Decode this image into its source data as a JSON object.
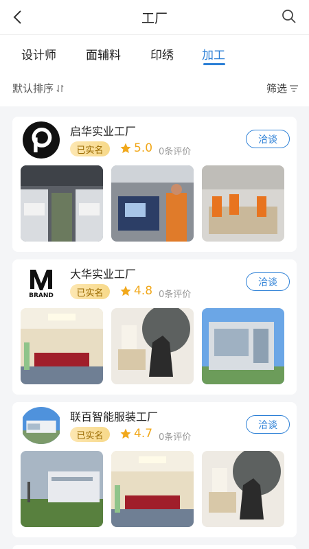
{
  "header": {
    "title": "工厂",
    "back_icon": "chevron-left-icon",
    "search_icon": "search-icon"
  },
  "tabs": [
    {
      "label": "设计师",
      "active": false
    },
    {
      "label": "面辅料",
      "active": false
    },
    {
      "label": "印绣",
      "active": false
    },
    {
      "label": "加工",
      "active": true
    }
  ],
  "sort": {
    "default_label": "默认排序",
    "sort_icon": "sort-arrows-icon",
    "filter_label": "筛选",
    "filter_icon": "filter-lines-icon"
  },
  "accent_color": "#2b7fd6",
  "rating_color": "#f1a81b",
  "factories": [
    {
      "name": "启华实业工厂",
      "verified": "已实名",
      "rating": "5.0",
      "reviews": "0条评价",
      "chat": "洽谈",
      "logo": "pinterest-style-p-logo",
      "photos": [
        "garment-factory-floor",
        "sewing-machine-workers",
        "workshop-tables-workers"
      ]
    },
    {
      "name": "大华实业工厂",
      "verified": "已实名",
      "rating": "4.8",
      "reviews": "0条评价",
      "chat": "洽谈",
      "logo": "brand-m-logo",
      "logo_text": "BRAND",
      "photos": [
        "conference-meeting-room",
        "qipao-dress-display",
        "modern-office-building"
      ]
    },
    {
      "name": "联百智能服装工厂",
      "verified": "已实名",
      "rating": "4.7",
      "reviews": "0条评价",
      "chat": "洽谈",
      "logo": "factory-building-photo",
      "photos": [
        "factory-exterior-lawn",
        "conference-meeting-room",
        "qipao-dress-display"
      ]
    }
  ]
}
